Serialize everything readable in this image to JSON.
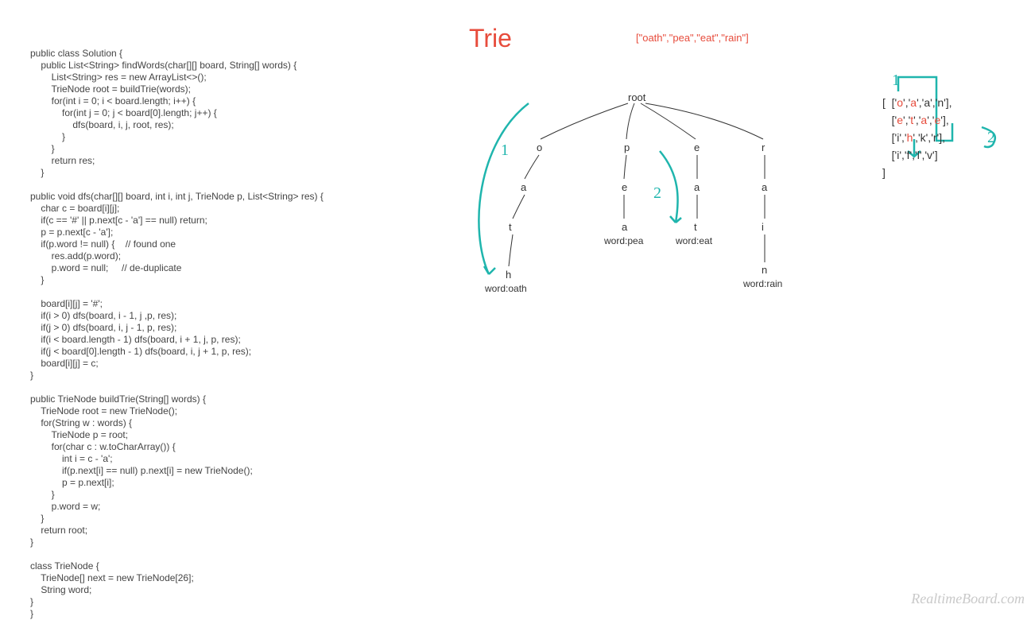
{
  "code": "public class Solution {\n    public List<String> findWords(char[][] board, String[] words) {\n        List<String> res = new ArrayList<>();\n        TrieNode root = buildTrie(words);\n        for(int i = 0; i < board.length; i++) {\n            for(int j = 0; j < board[0].length; j++) {\n                dfs(board, i, j, root, res);\n            }\n        }\n        return res;\n    }\n\npublic void dfs(char[][] board, int i, int j, TrieNode p, List<String> res) {\n    char c = board[i][j];\n    if(c == '#' || p.next[c - 'a'] == null) return;\n    p = p.next[c - 'a'];\n    if(p.word != null) {    // found one\n        res.add(p.word);\n        p.word = null;     // de-duplicate\n    }\n\n    board[i][j] = '#';\n    if(i > 0) dfs(board, i - 1, j ,p, res);\n    if(j > 0) dfs(board, i, j - 1, p, res);\n    if(i < board.length - 1) dfs(board, i + 1, j, p, res);\n    if(j < board[0].length - 1) dfs(board, i, j + 1, p, res);\n    board[i][j] = c;\n}\n\npublic TrieNode buildTrie(String[] words) {\n    TrieNode root = new TrieNode();\n    for(String w : words) {\n        TrieNode p = root;\n        for(char c : w.toCharArray()) {\n            int i = c - 'a';\n            if(p.next[i] == null) p.next[i] = new TrieNode();\n            p = p.next[i];\n        }\n        p.word = w;\n    }\n    return root;\n}\n\nclass TrieNode {\n    TrieNode[] next = new TrieNode[26];\n    String word;\n}\n}",
  "title": "Trie",
  "words_header": "[\"oath\",\"pea\",\"eat\",\"rain\"]",
  "trie": {
    "root": "root",
    "o": "o",
    "oa": "a",
    "oat": "t",
    "oath": "h",
    "oath_word": "word:oath",
    "p": "p",
    "pe": "e",
    "pea": "a",
    "pea_word": "word:pea",
    "e": "e",
    "ea": "a",
    "eat": "t",
    "eat_word": "word:eat",
    "r": "r",
    "ra": "a",
    "rai": "i",
    "rain": "n",
    "rain_word": "word:rain"
  },
  "board": {
    "bracket_open": "[",
    "row0_pre": "['",
    "row0_c0": "o",
    "row0_m1": "','",
    "row0_c1": "a",
    "row0_m2": "','a','n'],",
    "row1_pre": "['",
    "row1_c0": "e",
    "row1_m1": "','",
    "row1_c1": "t",
    "row1_m2": "','",
    "row1_c2": "a",
    "row1_m3": "','",
    "row1_c3": "e",
    "row1_m4": "'],",
    "row2_pre": "['i','",
    "row2_c1": "h",
    "row2_m2": "','k','r'],",
    "row3": "['i','f','l','v']",
    "bracket_close": "]"
  },
  "annot": {
    "one_left": "1",
    "two_mid": "2",
    "one_right": "1",
    "two_right": "2"
  },
  "watermark": "RealtimeBoard.com"
}
